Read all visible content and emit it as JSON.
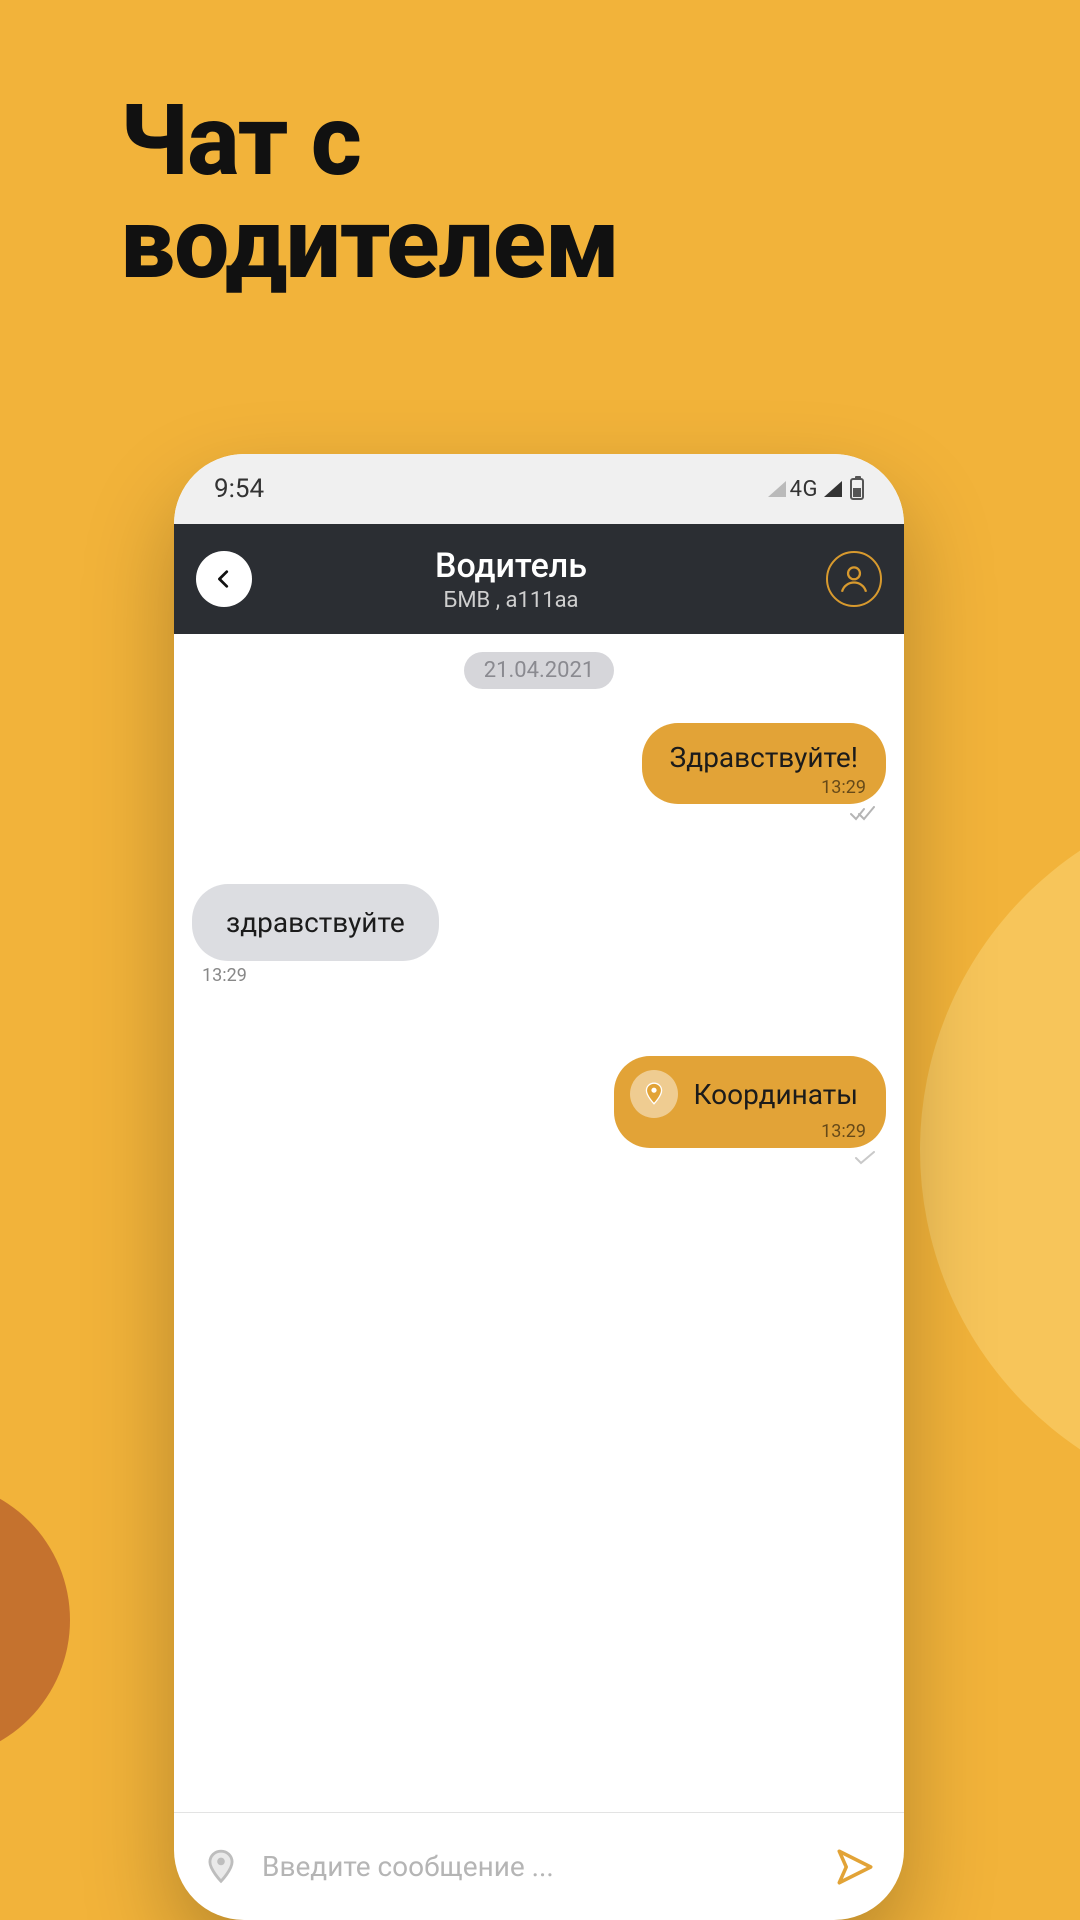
{
  "promo": {
    "headline_line1": "Чат с",
    "headline_line2": "водителем"
  },
  "statusbar": {
    "time": "9:54",
    "network": "4G"
  },
  "header": {
    "title": "Водитель",
    "subtitle": "БМВ , a111aa"
  },
  "chat": {
    "date": "21.04.2021",
    "messages": [
      {
        "side": "out",
        "text": "Здравствуйте!",
        "time": "13:29",
        "icon": null
      },
      {
        "side": "in",
        "text": "здравствуйте",
        "time": "13:29",
        "icon": null
      },
      {
        "side": "out",
        "text": "Координаты",
        "time": "13:29",
        "icon": "pin"
      }
    ]
  },
  "composer": {
    "placeholder": "Введите сообщение ..."
  }
}
